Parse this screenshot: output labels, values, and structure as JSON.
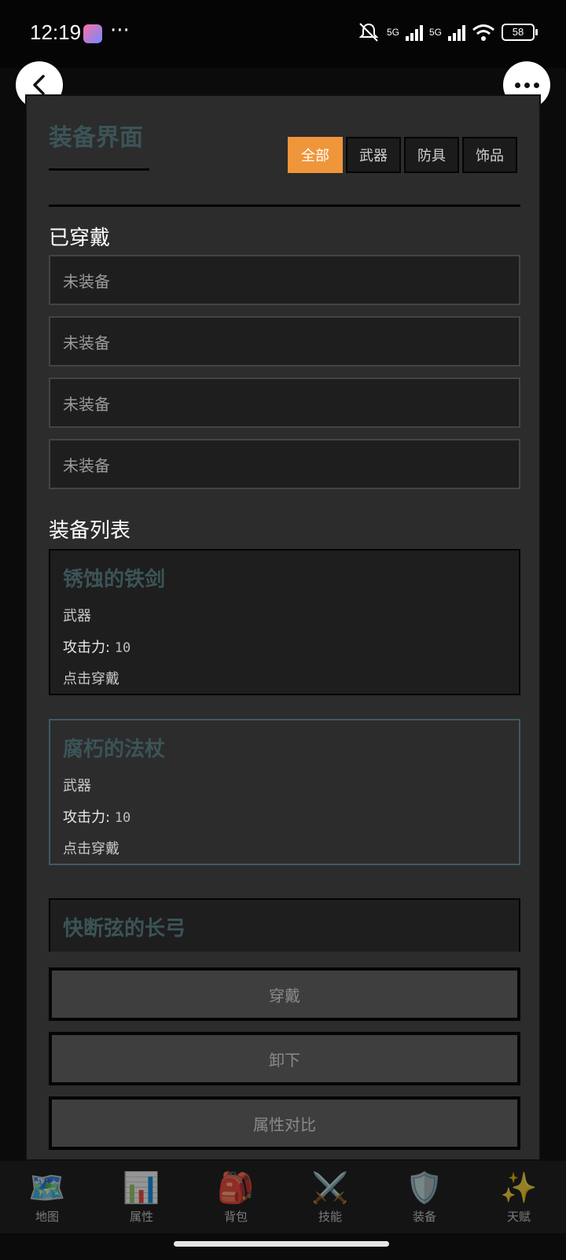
{
  "status_bar": {
    "time": "12:19",
    "more": "···",
    "net1": "5G",
    "net2": "5G",
    "battery": "58"
  },
  "header": {
    "back_icon": "chevron-left-icon",
    "menu_icon": "more-dots-icon"
  },
  "panel": {
    "title": "装备界面",
    "tabs": [
      {
        "label": "全部",
        "active": true
      },
      {
        "label": "武器",
        "active": false
      },
      {
        "label": "防具",
        "active": false
      },
      {
        "label": "饰品",
        "active": false
      }
    ],
    "equipped": {
      "heading": "已穿戴",
      "slots": [
        "未装备",
        "未装备",
        "未装备",
        "未装备"
      ]
    },
    "list": {
      "heading": "装备列表",
      "items": [
        {
          "name": "锈蚀的铁剑",
          "type": "武器",
          "stat_label": "攻击力:",
          "stat_value": "10",
          "hint": "点击穿戴"
        },
        {
          "name": "腐朽的法杖",
          "type": "武器",
          "stat_label": "攻击力:",
          "stat_value": "10",
          "hint": "点击穿戴"
        },
        {
          "name": "快断弦的长弓"
        }
      ]
    },
    "actions": {
      "equip": "穿戴",
      "unequip": "卸下",
      "compare": "属性对比"
    }
  },
  "bottom_nav": [
    {
      "label": "地图",
      "icon": "🗺️"
    },
    {
      "label": "属性",
      "icon": "📊"
    },
    {
      "label": "背包",
      "icon": "🎒"
    },
    {
      "label": "技能",
      "icon": "⚔️"
    },
    {
      "label": "装备",
      "icon": "🛡️"
    },
    {
      "label": "天赋",
      "icon": "✨"
    }
  ],
  "colors": {
    "accent": "#f0963a",
    "title": "#3b5457",
    "panel_bg": "#2c2c2c"
  }
}
